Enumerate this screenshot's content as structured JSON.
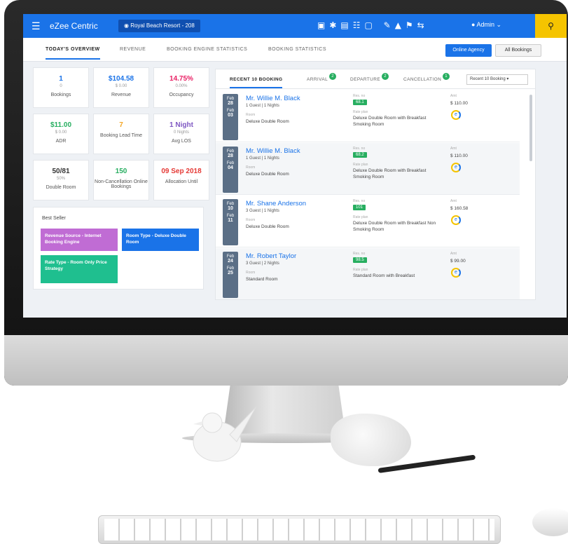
{
  "app": {
    "name": "eZee Centric",
    "property": "Royal Beach Resort - 208",
    "user": "Admin"
  },
  "main_tabs": [
    "TODAY'S OVERVIEW",
    "REVENUE",
    "BOOKING ENGINE STATISTICS",
    "BOOKING STATISTICS"
  ],
  "buttons": {
    "online_agency": "Online Agency",
    "all_bookings": "All Bookings"
  },
  "stats": [
    {
      "value": "1",
      "sub": "0",
      "label": "Bookings",
      "color": "#1a73e8"
    },
    {
      "value": "$104.58",
      "sub": "$ 0.00",
      "label": "Revenue",
      "color": "#1a73e8"
    },
    {
      "value": "14.75%",
      "sub": "0.00%",
      "label": "Occupancy",
      "color": "#e91e63"
    },
    {
      "value": "$11.00",
      "sub": "$ 0.00",
      "label": "ADR",
      "color": "#27ae60"
    },
    {
      "value": "7",
      "sub": "",
      "label": "Booking Lead Time",
      "color": "#f5a623"
    },
    {
      "value": "1 Night",
      "sub": "0 Nights",
      "label": "Avg LOS",
      "color": "#7e57c2"
    },
    {
      "value": "50/81",
      "sub": "50%",
      "label": "Double Room",
      "color": "#333333"
    },
    {
      "value": "150",
      "sub": "",
      "label": "Non-Cancellation Online Bookings",
      "color": "#27ae60"
    },
    {
      "value": "09 Sep 2018",
      "sub": "",
      "label": "Allocation Until",
      "color": "#e53935"
    }
  ],
  "best_seller": {
    "title": "Best Seller",
    "boxes": [
      {
        "text": "Revenue Source - Internet Booking Engine",
        "color": "#c06cd4"
      },
      {
        "text": "Room Type - Deluxe Double Room",
        "color": "#1a73e8"
      },
      {
        "text": "Rate Type - Room Only Price Strategy",
        "color": "#1fbf8f"
      }
    ]
  },
  "booking_tabs": [
    {
      "label": "RECENT 10 BOOKING",
      "badge": ""
    },
    {
      "label": "ARRIVAL",
      "badge": "2"
    },
    {
      "label": "DEPARTURE",
      "badge": "2"
    },
    {
      "label": "CANCELLATION",
      "badge": "1"
    }
  ],
  "booking_select": "Recent 10 Booking",
  "bookings": [
    {
      "mon": "Feb",
      "d1": "28",
      "d2": "03",
      "name": "Mr. Willie M. Black",
      "guests": "1 Guest | 1 Nights",
      "room_label": "Room",
      "room": "Deluxe Double Room",
      "res_label": "Res. no",
      "res": "68.1",
      "rate_label": "Rate plan",
      "rate": "Deluxe Double Room with Breakfast Smoking Room",
      "amt_label": "Amt",
      "amt": "$ 110.00"
    },
    {
      "mon": "Feb",
      "d1": "28",
      "d2": "04",
      "name": "Mr. Willie M. Black",
      "guests": "1 Guest | 1 Nights",
      "room_label": "Room",
      "room": "Deluxe Double Room",
      "res_label": "Res. no",
      "res": "68.2",
      "rate_label": "Rate plan",
      "rate": "Deluxe Double Room with Breakfast Smoking Room",
      "amt_label": "Amt",
      "amt": "$ 110.00"
    },
    {
      "mon": "Feb",
      "d1": "10",
      "d2": "11",
      "name": "Mr. Shane Anderson",
      "guests": "3 Guest | 1 Nights",
      "room_label": "Room",
      "room": "Deluxe Double Room",
      "res_label": "Res. no",
      "res": "101",
      "rate_label": "Rate plan",
      "rate": "Deluxe Double Room with Breakfast Non Smoking Room",
      "amt_label": "Amt",
      "amt": "$ 160.58"
    },
    {
      "mon": "Feb",
      "d1": "24",
      "d2": "25",
      "name": "Mr. Robert Taylor",
      "guests": "3 Guest | 2 Nights",
      "room_label": "Room",
      "room": "Standard Room",
      "res_label": "Res. no",
      "res": "98.5",
      "rate_label": "Rate plan",
      "rate": "Standard Room with Breakfast",
      "amt_label": "Amt",
      "amt": "$ 99.00"
    }
  ],
  "icons": [
    "menu-icon",
    "search-icon",
    "calendar-icon",
    "gear-icon",
    "bell-icon",
    "user-icon"
  ]
}
